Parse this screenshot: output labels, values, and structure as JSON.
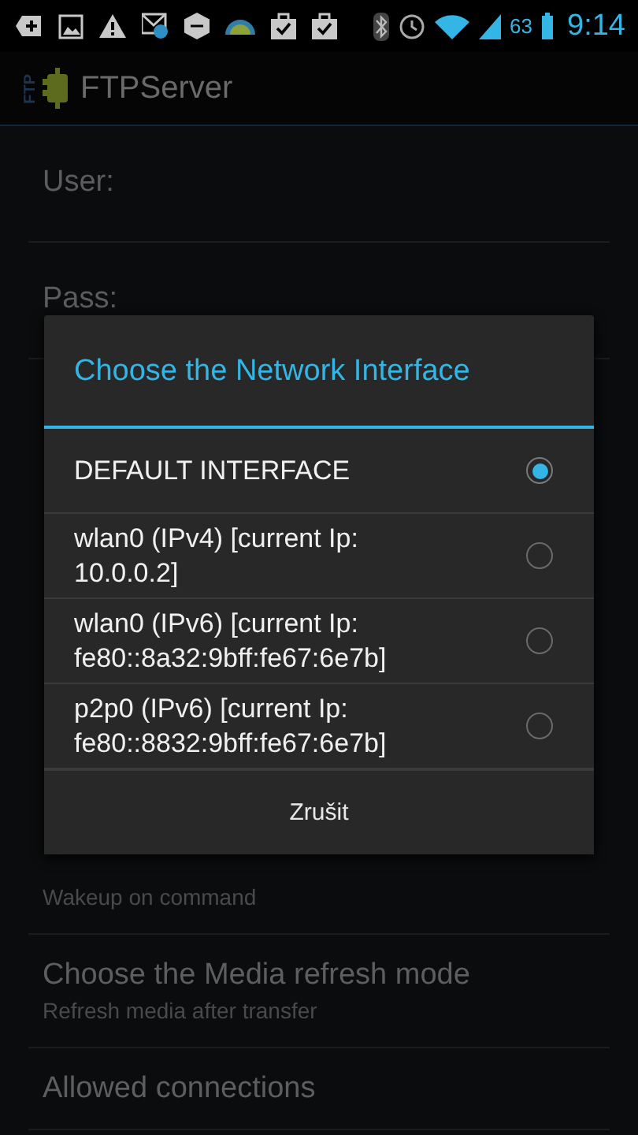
{
  "status_bar": {
    "battery": "63",
    "time": "9:14"
  },
  "action_bar": {
    "logo_text": "FTP",
    "title": "FTPServer"
  },
  "settings": [
    {
      "kind": "field",
      "label": "User:"
    },
    {
      "kind": "field",
      "label": "Pass:"
    },
    {
      "kind": "pref",
      "summary": "Wakeup on command"
    },
    {
      "kind": "pref",
      "title": "Choose the Media refresh mode",
      "summary": "Refresh media after transfer"
    },
    {
      "kind": "pref",
      "title": "Allowed connections"
    }
  ],
  "dialog": {
    "title": "Choose the Network Interface",
    "options": [
      {
        "label": "DEFAULT INTERFACE",
        "selected": true
      },
      {
        "label": "wlan0 (IPv4) [current Ip: 10.0.0.2]",
        "selected": false
      },
      {
        "label": "wlan0 (IPv6) [current Ip: fe80::8a32:9bff:fe67:6e7b]",
        "selected": false
      },
      {
        "label": "p2p0 (IPv6) [current Ip: fe80::8832:9bff:fe67:6e7b]",
        "selected": false
      }
    ],
    "button": "Zrušit"
  }
}
